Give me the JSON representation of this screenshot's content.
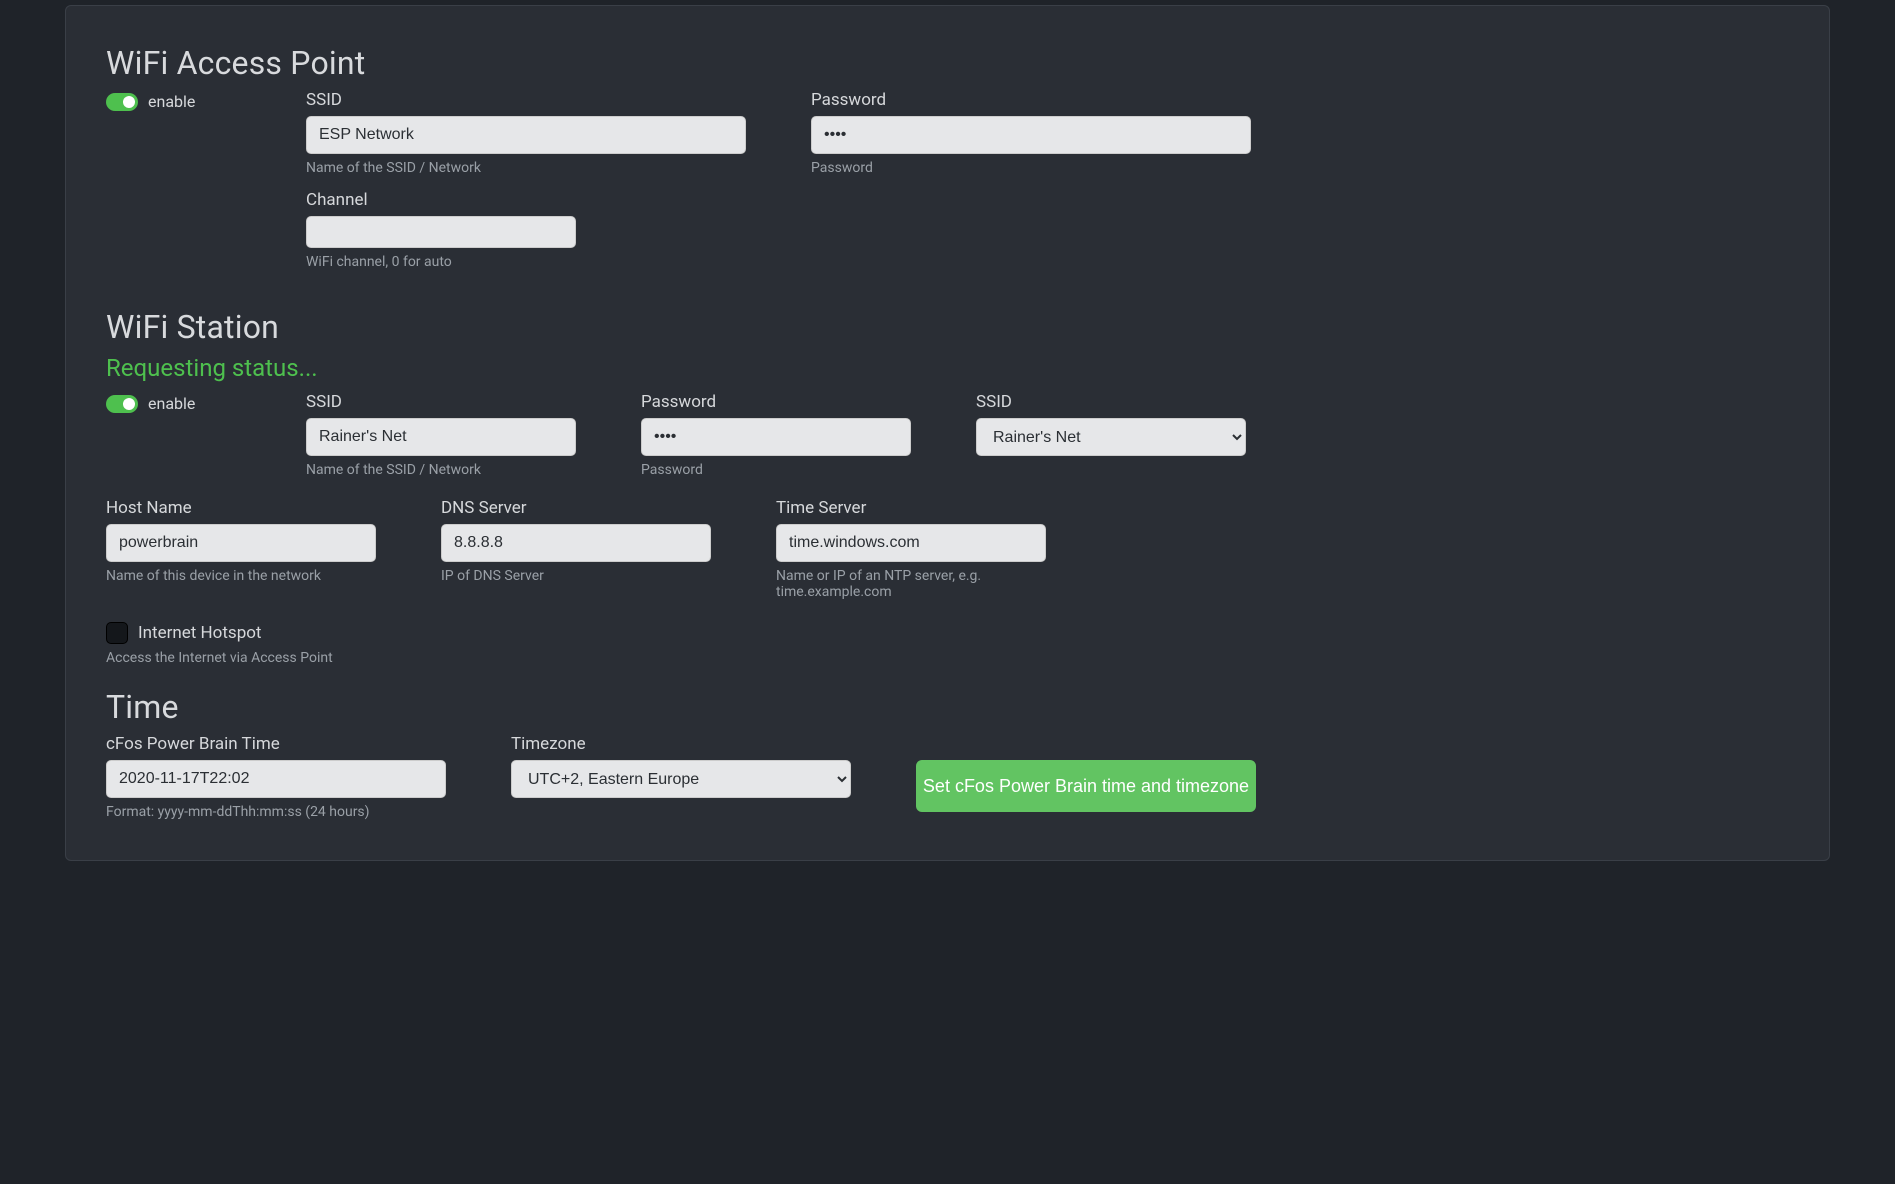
{
  "ap": {
    "title": "WiFi Access Point",
    "enable_label": "enable",
    "enable_on": true,
    "ssid_label": "SSID",
    "ssid_value": "ESP Network",
    "ssid_help": "Name of the SSID / Network",
    "password_label": "Password",
    "password_value": "••••",
    "password_help": "Password",
    "channel_label": "Channel",
    "channel_value": "",
    "channel_help": "WiFi channel, 0 for auto"
  },
  "sta": {
    "title": "WiFi Station",
    "status_text": "Requesting status...",
    "enable_label": "enable",
    "enable_on": true,
    "ssid_label": "SSID",
    "ssid_value": "Rainer's Net",
    "ssid_help": "Name of the SSID / Network",
    "password_label": "Password",
    "password_value": "••••",
    "password_help": "Password",
    "select_label": "SSID",
    "select_value": "Rainer's Net",
    "host_label": "Host Name",
    "host_value": "powerbrain",
    "host_help": "Name of this device in the network",
    "dns_label": "DNS Server",
    "dns_value": "8.8.8.8",
    "dns_help": "IP of DNS Server",
    "ts_label": "Time Server",
    "ts_value": "time.windows.com",
    "ts_help": "Name or IP of an NTP server, e.g. time.example.com",
    "hotspot_label": "Internet Hotspot",
    "hotspot_checked": false,
    "hotspot_help": "Access the Internet via Access Point"
  },
  "time": {
    "title": "Time",
    "time_label": "cFos Power Brain Time",
    "time_value": "2020-11-17T22:02",
    "time_help": "Format: yyyy-mm-ddThh:mm:ss (24 hours)",
    "tz_label": "Timezone",
    "tz_value": "UTC+2, Eastern Europe",
    "button_label": "Set cFos Power Brain time and timezone"
  }
}
